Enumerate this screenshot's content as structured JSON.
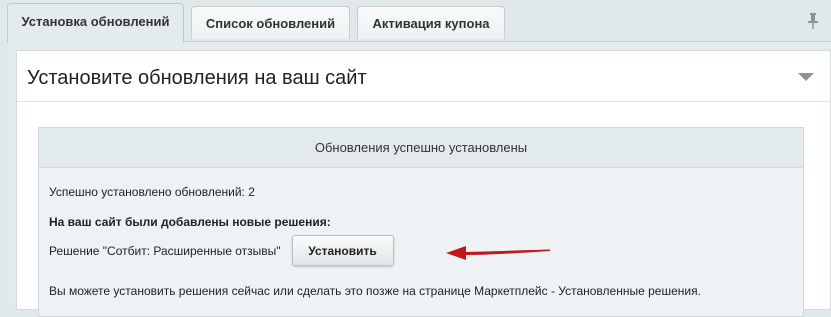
{
  "tabs": [
    {
      "label": "Установка обновлений",
      "active": true
    },
    {
      "label": "Список обновлений",
      "active": false
    },
    {
      "label": "Активация купона",
      "active": false
    }
  ],
  "card": {
    "title": "Установите обновления на ваш сайт"
  },
  "notice": {
    "header": "Обновления успешно установлены",
    "installed_count_text": "Успешно установлено обновлений: 2",
    "new_solutions_heading": "На ваш сайт были добавлены новые решения:",
    "solution_text": "Решение \"Сотбит: Расширенные отзывы\"",
    "install_button": "Установить",
    "note": "Вы можете установить решения сейчас или сделать это позже на странице Маркетплейс - Установленные решения."
  },
  "icons": {
    "pin": "pin-icon",
    "collapse": "chevron-down-icon",
    "arrow": "arrow-left-icon"
  },
  "colors": {
    "background": "#e0e8ea",
    "arrow": "#c0161c"
  }
}
